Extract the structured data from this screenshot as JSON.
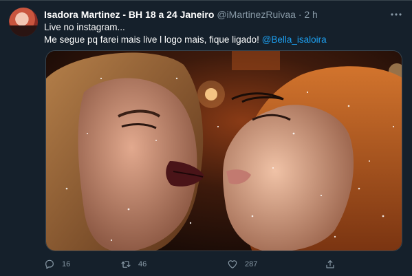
{
  "tweet": {
    "display_name": "Isadora Martinez - BH 18 a 24 Janeiro",
    "handle": "@iMartinezRuivaa",
    "separator": "·",
    "time": "2 h",
    "text_line1": "Live no instagram...",
    "text_line2": "Me segue pq farei mais live l logo mais, fique ligado!",
    "mention": "@Bella_isaloira",
    "media_description": "",
    "actions": {
      "reply_count": "16",
      "retweet_count": "46",
      "like_count": "287"
    },
    "icons": {
      "more": "more-horizontal-icon",
      "reply": "reply-icon",
      "retweet": "retweet-icon",
      "like": "heart-icon",
      "share": "share-icon"
    },
    "colors": {
      "background": "#15202b",
      "text": "#ffffff",
      "secondary": "#8899a6",
      "link": "#1da1f2",
      "border": "#38444d"
    }
  }
}
